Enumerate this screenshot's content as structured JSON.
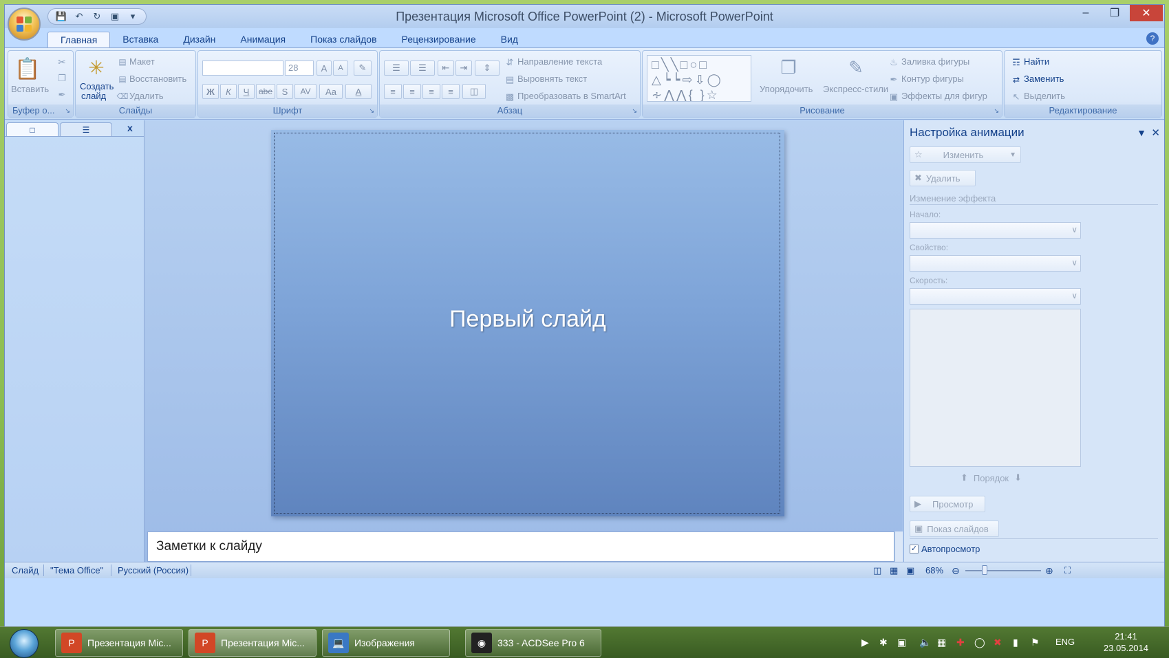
{
  "window": {
    "title": "Презентация Microsoft Office PowerPoint (2) - Microsoft PowerPoint",
    "minimize": "–",
    "restore": "❐",
    "close": "✕"
  },
  "tabs": [
    "Главная",
    "Вставка",
    "Дизайн",
    "Анимация",
    "Показ слайдов",
    "Рецензирование",
    "Вид"
  ],
  "ribbon": {
    "clipboard": {
      "paste": "Вставить",
      "label": "Буфер о..."
    },
    "slides": {
      "new_slide_line1": "Создать",
      "new_slide_line2": "слайд",
      "layout": "Макет",
      "reset": "Восстановить",
      "delete": "Удалить",
      "label": "Слайды"
    },
    "font": {
      "size": "28",
      "grow": "A",
      "shrink": "A",
      "bold": "Ж",
      "italic": "К",
      "underline": "Ч",
      "strike": "abe",
      "shadow": "S",
      "spacing": "AV",
      "case": "Aa",
      "color": "A",
      "label": "Шрифт"
    },
    "paragraph": {
      "text_direction": "Направление текста",
      "align_text": "Выровнять текст",
      "smartart": "Преобразовать в SmartArt",
      "label": "Абзац"
    },
    "drawing": {
      "arrange": "Упорядочить",
      "quick_styles": "Экспресс-стили",
      "fill": "Заливка фигуры",
      "outline": "Контур фигуры",
      "effects": "Эффекты для фигур",
      "label": "Рисование"
    },
    "editing": {
      "find": "Найти",
      "replace": "Заменить",
      "select": "Выделить",
      "label": "Редактирование"
    }
  },
  "left_pane": {
    "close": "x"
  },
  "slide": {
    "title": "Первый слайд"
  },
  "notes": {
    "text": "Заметки к слайду"
  },
  "animation_pane": {
    "title": "Настройка анимации",
    "change": "Изменить",
    "remove": "Удалить",
    "modify_heading": "Изменение эффекта",
    "start_label": "Начало:",
    "property_label": "Свойство:",
    "speed_label": "Скорость:",
    "order": "Порядок",
    "preview": "Просмотр",
    "slideshow": "Показ слайдов",
    "autopreview": "Автопросмотр"
  },
  "status": {
    "slide": "Слайд",
    "theme": "\"Тема Office\"",
    "language": "Русский (Россия)",
    "zoom": "68%"
  },
  "taskbar": {
    "items": [
      "Презентация Mic...",
      "Презентация Mic...",
      "Изображения",
      "333 - ACDSee Pro 6"
    ],
    "language": "ENG",
    "time": "21:41",
    "date": "23.05.2014"
  },
  "colors": {
    "accent": "#15428b",
    "ribbon": "#dbe8f9",
    "slide": "#7ea4d8",
    "office_orange": "#f2c256"
  }
}
